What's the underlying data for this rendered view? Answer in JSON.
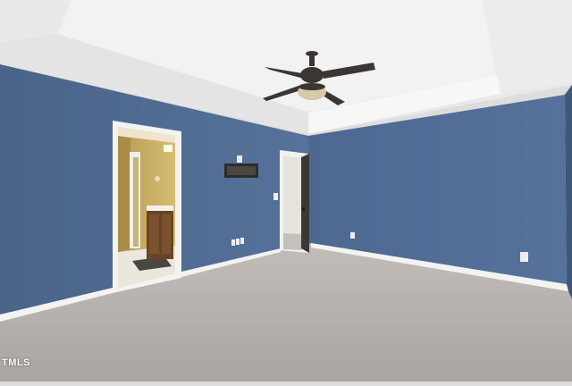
{
  "photo": {
    "subject": "empty-bedroom-interior",
    "watermark_text": "TMLS"
  },
  "colors": {
    "wall_blue": "#4f6b8f",
    "wall_blue_dark": "#3f5878",
    "ceiling": "#eeeeee",
    "carpet": "#b7b2ae",
    "trim": "#f3f3f1",
    "bath_wall": "#c9ad5f",
    "vanity_wood": "#6b4424",
    "fan_dark": "#3b3633",
    "fan_light": "#d8c9a6"
  }
}
